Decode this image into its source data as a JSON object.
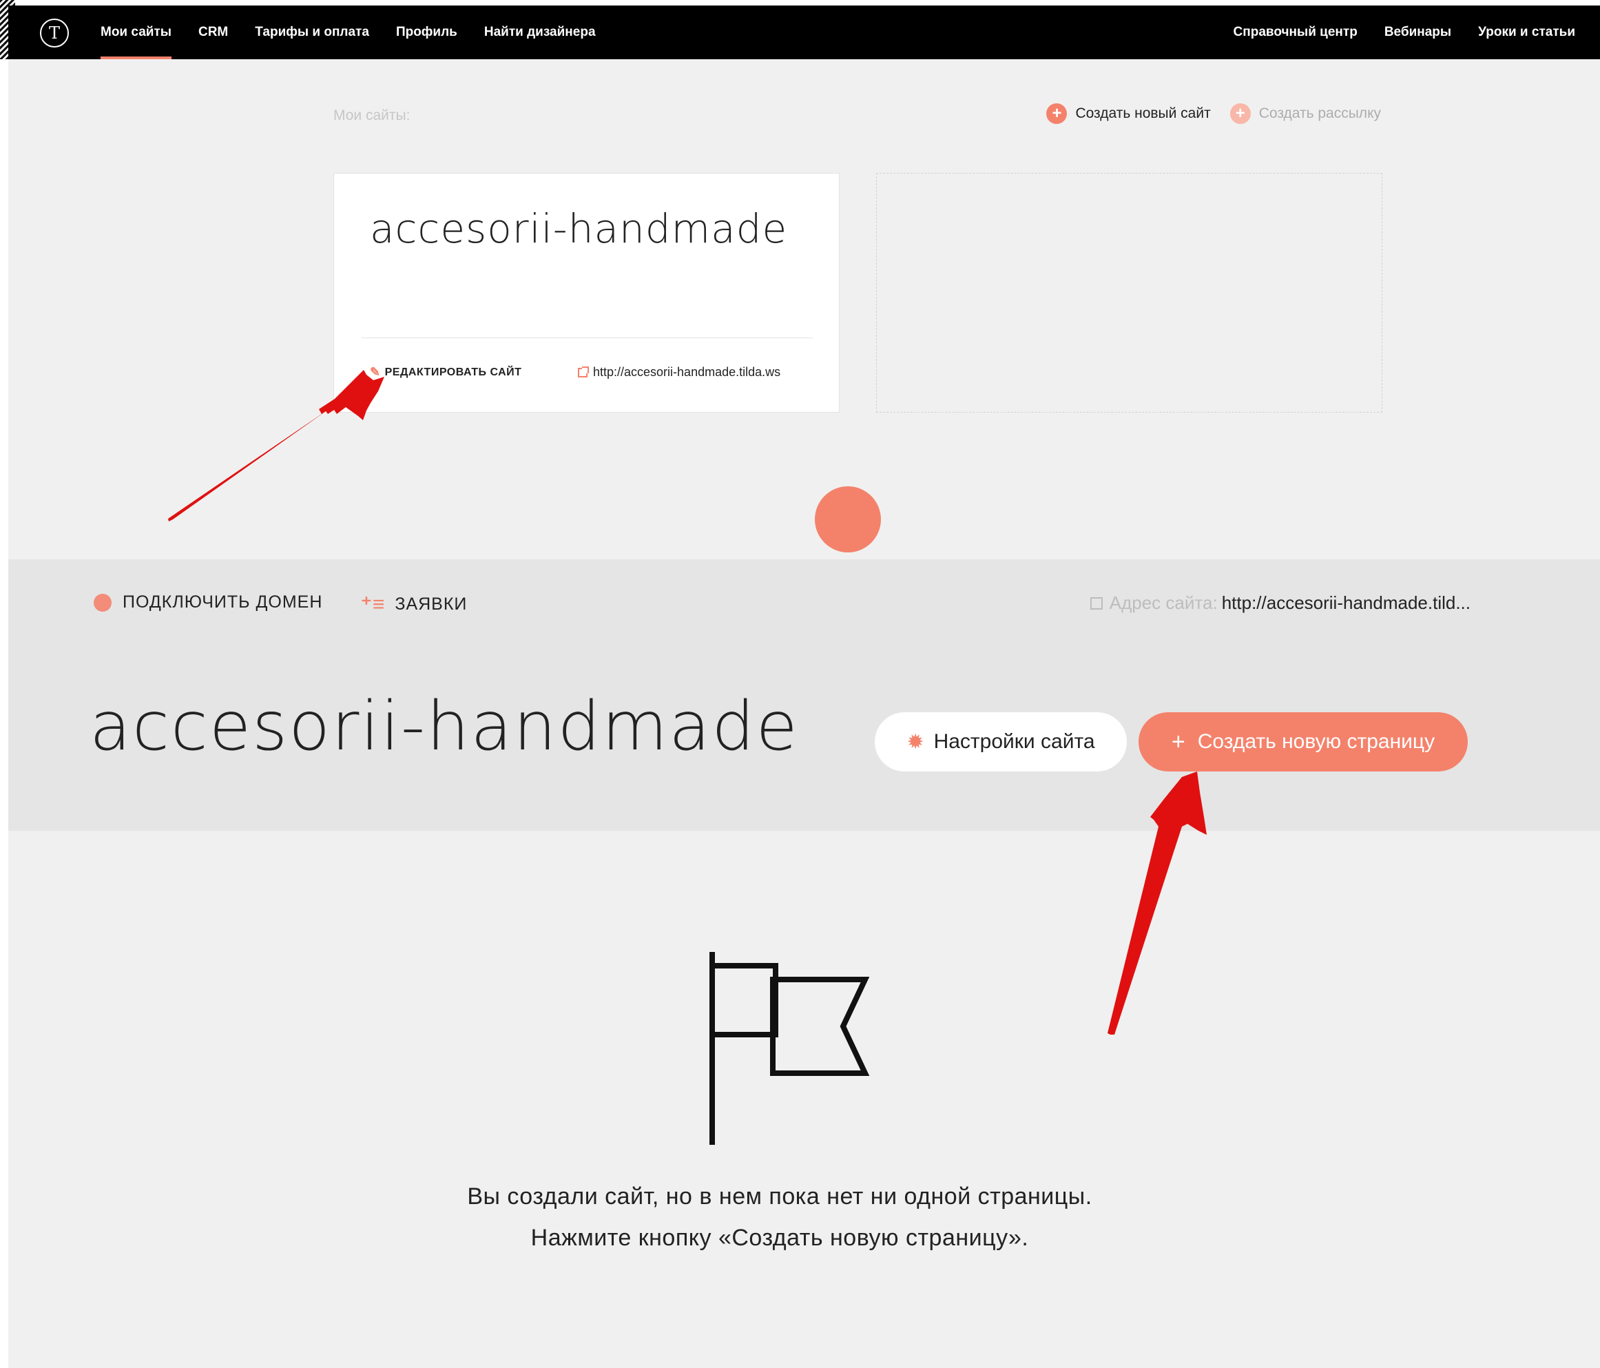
{
  "nav": {
    "logo": "Т",
    "left_items": [
      "Мои сайты",
      "CRM",
      "Тарифы и оплата",
      "Профиль",
      "Найти дизайнера"
    ],
    "right_items": [
      "Справочный центр",
      "Вебинары",
      "Уроки и статьи"
    ]
  },
  "sites_panel": {
    "label": "Мои сайты:",
    "create_site": "Создать новый сайт",
    "create_mailing": "Создать рассылку",
    "card": {
      "title": "accesorii-handmade",
      "edit": "РЕДАКТИРОВАТЬ САЙТ",
      "url": "http://accesorii-handmade.tilda.ws"
    }
  },
  "site_header": {
    "connect_domain": "ПОДКЛЮЧИТЬ ДОМЕН",
    "requests": "ЗАЯВКИ",
    "address_label": "Адрес сайта:",
    "address_value": "http://accesorii-handmade.tild...",
    "title": "accesorii-handmade",
    "settings_button": "Настройки сайта",
    "create_page_button": "Создать новую страницу"
  },
  "empty_state": {
    "line1": "Вы создали сайт, но в нем пока нет ни одной страницы.",
    "line2": "Нажмите кнопку «Создать новую страницу»."
  },
  "colors": {
    "accent": "#f4826b",
    "nav_bg": "#000000",
    "panel_bg": "#f0f0f0",
    "header_bg": "#e5e5e5",
    "annotation_arrow": "#e01010"
  },
  "icons": [
    "logo-icon",
    "plus-circle-icon",
    "pencil-icon",
    "external-link-icon",
    "globe-icon",
    "list-icon",
    "gear-icon",
    "plus-icon",
    "flag-icon",
    "arrow-annotation"
  ]
}
